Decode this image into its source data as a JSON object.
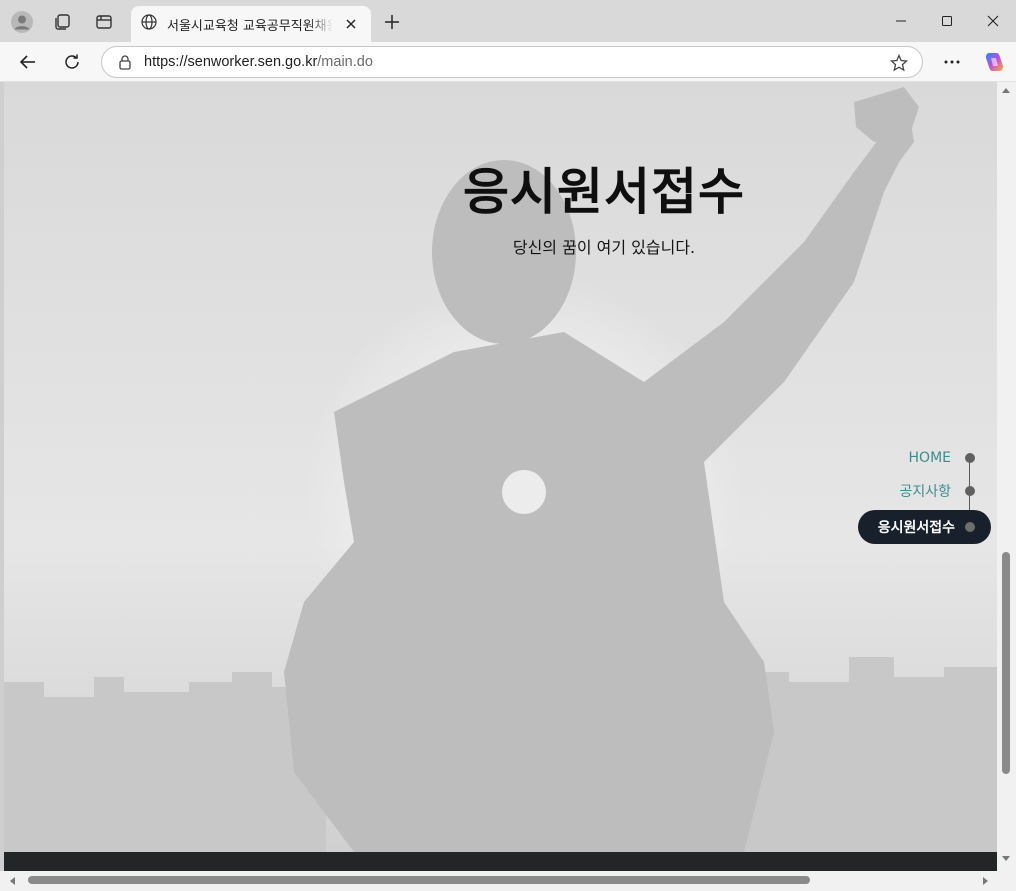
{
  "browser": {
    "tab_title": "서울시교육청 교육공무직원채용 시스템",
    "url_host": "https://senworker.sen.go.kr",
    "url_path": "/main.do"
  },
  "hero": {
    "title": "응시원서접수",
    "subtitle": "당신의 꿈이 여기 있습니다."
  },
  "sidenav": {
    "items": [
      {
        "label": "HOME"
      },
      {
        "label": "공지사항"
      },
      {
        "label": "응시원서접수"
      }
    ],
    "active_index": 2
  },
  "colors": {
    "nav_link": "#3d8c90",
    "nav_active_bg": "#18202b",
    "footer": "#232627"
  }
}
